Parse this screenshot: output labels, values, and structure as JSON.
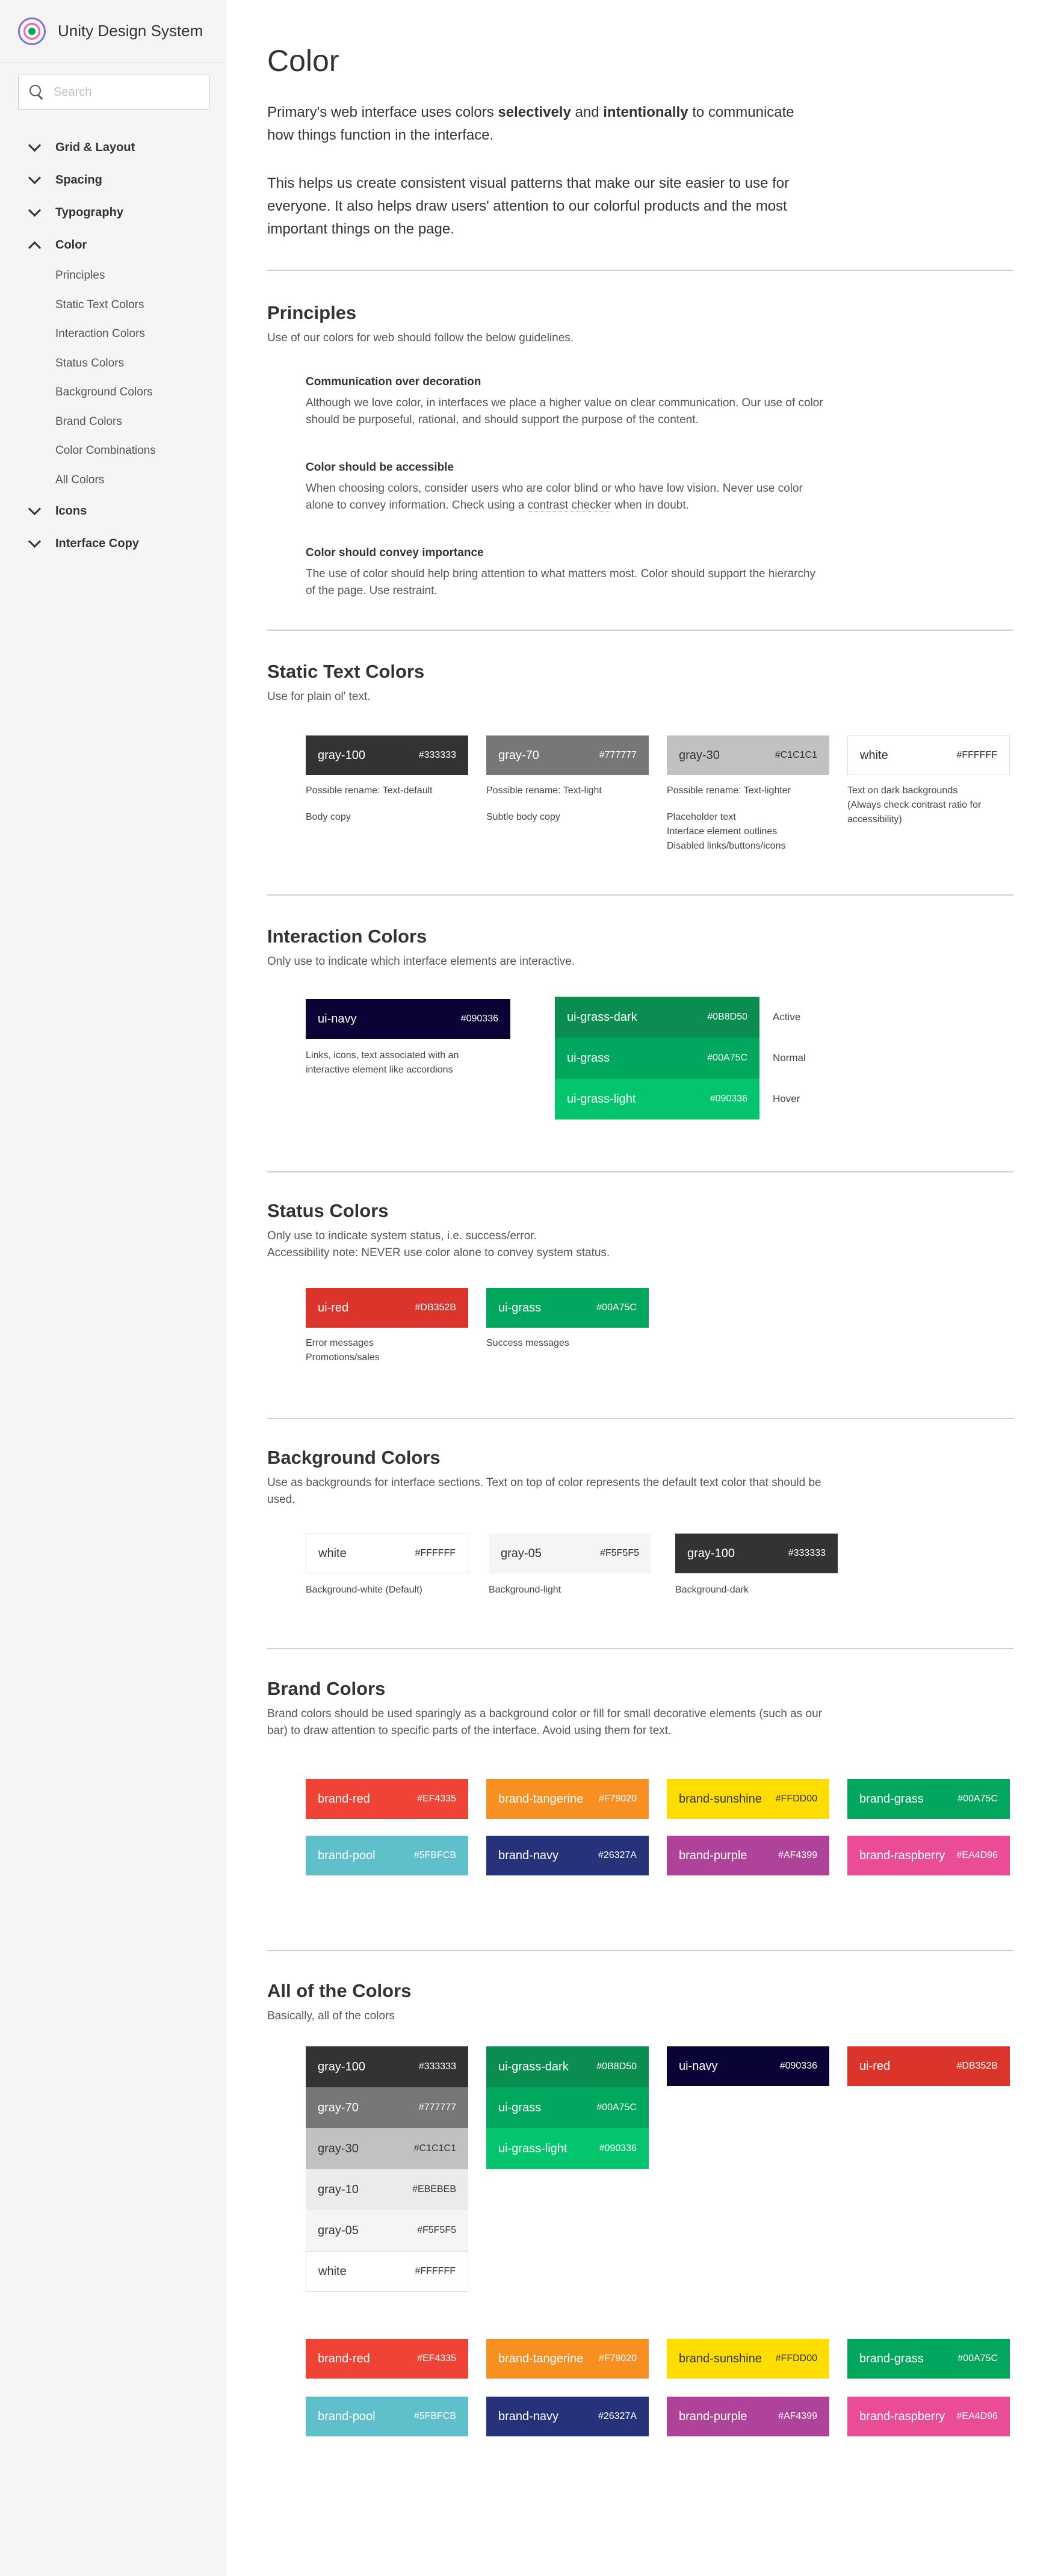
{
  "app": {
    "title": "Unity Design System"
  },
  "search": {
    "placeholder": "Search"
  },
  "nav": {
    "grid": "Grid & Layout",
    "spacing": "Spacing",
    "typography": "Typography",
    "color": "Color",
    "color_sub": [
      "Principles",
      "Static Text Colors",
      "Interaction Colors",
      "Status Colors",
      "Background Colors",
      "Brand Colors",
      "Color Combinations",
      "All Colors"
    ],
    "icons": "Icons",
    "interface_copy": "Interface Copy"
  },
  "page": {
    "title": "Color",
    "intro1_a": "Primary's web interface uses colors ",
    "intro1_b": "selectively",
    "intro1_c": " and ",
    "intro1_d": "intentionally",
    "intro1_e": " to communicate how things function in the interface.",
    "intro2": "This helps us create consistent visual patterns that make our site easier to use for everyone. It also helps draw users' attention to our colorful products and the most important things on the page."
  },
  "principles": {
    "title": "Principles",
    "desc": "Use of our colors for web should follow the below guidelines.",
    "items": [
      {
        "title": "Communication over decoration",
        "body": "Although we love color, in interfaces we place a higher value on clear communication. Our use of color should be purposeful, rational, and should support the purpose of the content."
      },
      {
        "title": "Color should be accessible",
        "body_a": "When choosing colors, consider users who are color blind or who have low vision. Never use color alone to convey information. Check using a ",
        "link": "contrast checker",
        "body_b": " when in doubt."
      },
      {
        "title": "Color should convey importance",
        "body": "The use of color should help bring attention to what matters most. Color should support the hierarchy of the page. Use restraint."
      }
    ]
  },
  "static_text": {
    "title": "Static Text Colors",
    "desc": "Use for plain ol' text.",
    "swatches": [
      {
        "name": "gray-100",
        "hex": "#333333",
        "rename": "Possible rename: Text-default",
        "usage": "Body copy"
      },
      {
        "name": "gray-70",
        "hex": "#777777",
        "rename": "Possible rename: Text-light",
        "usage": "Subtle body copy"
      },
      {
        "name": "gray-30",
        "hex": "#C1C1C1",
        "rename": "Possible rename: Text-lighter",
        "usage": "Placeholder text\nInterface element outlines\nDisabled links/buttons/icons"
      },
      {
        "name": "white",
        "hex": "#FFFFFF",
        "rename": "Text on dark backgrounds\n(Always check contrast ratio for accessibility)",
        "usage": ""
      }
    ]
  },
  "interaction": {
    "title": "Interaction Colors",
    "desc": "Only use to indicate which interface elements are interactive.",
    "navy": {
      "name": "ui-navy",
      "hex": "#090336",
      "note": "Links, icons, text associated with an\ninteractive element like accordions"
    },
    "grass": [
      {
        "name": "ui-grass-dark",
        "hex": "#0B8D50",
        "state": "Active"
      },
      {
        "name": "ui-grass",
        "hex": "#00A75C",
        "state": "Normal"
      },
      {
        "name": "ui-grass-light",
        "hex": "#090336",
        "state": "Hover"
      }
    ]
  },
  "status": {
    "title": "Status Colors",
    "desc1": "Only use to indicate system status, i.e. success/error.",
    "desc2": "Accessibility note: NEVER use color alone to convey system status.",
    "swatches": [
      {
        "name": "ui-red",
        "hex": "#DB352B",
        "note": "Error messages\nPromotions/sales"
      },
      {
        "name": "ui-grass",
        "hex": "#00A75C",
        "note": "Success messages"
      }
    ]
  },
  "background": {
    "title": "Background Colors",
    "desc": "Use as backgrounds for interface sections. Text on top of color represents the default text color that should be used.",
    "swatches": [
      {
        "name": "white",
        "hex": "#FFFFFF",
        "note": "Background-white (Default)"
      },
      {
        "name": "gray-05",
        "hex": "#F5F5F5",
        "note": "Background-light"
      },
      {
        "name": "gray-100",
        "hex": "#333333",
        "note": "Background-dark"
      }
    ]
  },
  "brand": {
    "title": "Brand Colors",
    "desc": "Brand colors should be used sparingly as a background color or fill for small decorative elements (such as our bar) to draw attention to specific parts of the interface. Avoid using them for text.",
    "swatches": [
      {
        "name": "brand-red",
        "hex": "#EF4335"
      },
      {
        "name": "brand-tangerine",
        "hex": "#F79020"
      },
      {
        "name": "brand-sunshine",
        "hex": "#FFDD00"
      },
      {
        "name": "brand-grass",
        "hex": "#00A75C"
      },
      {
        "name": "brand-pool",
        "hex": "#5FBFCB"
      },
      {
        "name": "brand-navy",
        "hex": "#26327A"
      },
      {
        "name": "brand-purple",
        "hex": "#AF4399"
      },
      {
        "name": "brand-raspberry",
        "hex": "#EA4D96"
      }
    ]
  },
  "all": {
    "title": "All of the Colors",
    "desc": "Basically, all of the colors",
    "grays": [
      {
        "name": "gray-100",
        "hex": "#333333"
      },
      {
        "name": "gray-70",
        "hex": "#777777"
      },
      {
        "name": "gray-30",
        "hex": "#C1C1C1"
      },
      {
        "name": "gray-10",
        "hex": "#EBEBEB"
      },
      {
        "name": "gray-05",
        "hex": "#F5F5F5"
      },
      {
        "name": "white",
        "hex": "#FFFFFF"
      }
    ],
    "greens": [
      {
        "name": "ui-grass-dark",
        "hex": "#0B8D50"
      },
      {
        "name": "ui-grass",
        "hex": "#00A75C"
      },
      {
        "name": "ui-grass-light",
        "hex": "#090336"
      }
    ],
    "navy": {
      "name": "ui-navy",
      "hex": "#090336"
    },
    "red": {
      "name": "ui-red",
      "hex": "#DB352B"
    },
    "brand": [
      {
        "name": "brand-red",
        "hex": "#EF4335"
      },
      {
        "name": "brand-tangerine",
        "hex": "#F79020"
      },
      {
        "name": "brand-sunshine",
        "hex": "#FFDD00"
      },
      {
        "name": "brand-grass",
        "hex": "#00A75C"
      },
      {
        "name": "brand-pool",
        "hex": "#5FBFCB"
      },
      {
        "name": "brand-navy",
        "hex": "#26327A"
      },
      {
        "name": "brand-purple",
        "hex": "#AF4399"
      },
      {
        "name": "brand-raspberry",
        "hex": "#EA4D96"
      }
    ]
  },
  "fills": {
    "gray-100": "#333333",
    "gray-70": "#777777",
    "gray-30": "#c1c1c1",
    "gray-10": "#ebebeb",
    "gray-05": "#f5f5f5",
    "white": "#ffffff",
    "ui-navy": "#0a0436",
    "ui-grass-dark": "#0b8d50",
    "ui-grass": "#00a75c",
    "ui-grass-light": "#05c46e",
    "ui-red": "#db352b",
    "brand-red": "#ef4335",
    "brand-tangerine": "#f79020",
    "brand-sunshine": "#ffdd00",
    "brand-grass": "#00a75c",
    "brand-pool": "#5fbfcb",
    "brand-navy": "#26327a",
    "brand-purple": "#af4399",
    "brand-raspberry": "#ea4d96"
  }
}
